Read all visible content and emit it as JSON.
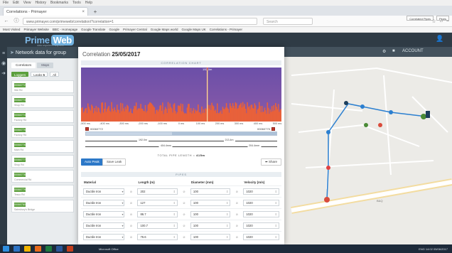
{
  "browser": {
    "menu": [
      "File",
      "Edit",
      "View",
      "History",
      "Bookmarks",
      "Tools",
      "Help"
    ],
    "tab_title": "Correlations - Primayer",
    "url": "www.primayer.com/primeweb/correlation/?correlation=1",
    "search_placeholder": "Search",
    "bookmarks": [
      "Most Visited",
      "Primayer Website",
      "BBC - Homepage",
      "Google Translate",
      "Google",
      "Primayer Central",
      "Google Maps world",
      "Google Maps UK",
      "Correlations - Primayer"
    ]
  },
  "app": {
    "logo_prime": "Prime",
    "logo_web": "Web",
    "logo_sub": "data anywhere, any time",
    "panel_title": "Network data for group",
    "tabs": [
      "Correlators",
      "Maps"
    ],
    "filters": [
      "Loggers",
      "Leaks",
      "All"
    ],
    "leak_count": "5",
    "loggers": [
      {
        "id": "00060772",
        "sub": "Site Rd"
      },
      {
        "id": "00060773",
        "sub": "Shop Rd"
      },
      {
        "id": "00060774",
        "sub": "Factory Rd"
      },
      {
        "id": "00060775",
        "sub": "Factory Rd"
      },
      {
        "id": "00060776",
        "sub": "Main Rd"
      },
      {
        "id": "00060777",
        "sub": "Shop Rd"
      },
      {
        "id": "00060778",
        "sub": "Commercial Rd"
      },
      {
        "id": "00060779",
        "sub": "Tesco Rd"
      },
      {
        "id": "00060780",
        "sub": "Sainsbury's Bridge"
      }
    ]
  },
  "map": {
    "toolbar_right": "ACCOUNT",
    "checks": [
      "Correlated Pipes",
      "Pipes"
    ]
  },
  "modal": {
    "title_prefix": "Correlation",
    "date": "25/05/2017",
    "chart_header": "CORRELATION CHART",
    "peak_label": "192.0m",
    "logger_a": "00060772",
    "logger_b": "00060775",
    "axis_ticks": [
      "-500 ms",
      "-400 ms",
      "-300 ms",
      "-200 ms",
      "-100 ms",
      "0 ms",
      "100 ms",
      "200 ms",
      "300 ms",
      "400 ms",
      "500 ms"
    ],
    "dim_left": "192.0m",
    "dim_right": "213.4m",
    "dim_a": "404.4mm",
    "dim_b": "204.4mm",
    "total_label": "TOTAL PIPE LENGTH =",
    "total_value": "415m",
    "buttons": {
      "primary": "Auto Peak",
      "secondary": "Save Leak",
      "share": "Share"
    },
    "pipes_header": "PIPES",
    "columns": [
      "Material",
      "Length (m)",
      "Diameter (mm)",
      "Velocity (m/s)"
    ],
    "rows": [
      {
        "material": "Ductile Iron",
        "length": "202",
        "diameter": "100",
        "velocity": "1020"
      },
      {
        "material": "Ductile Iron",
        "length": "127",
        "diameter": "100",
        "velocity": "1020"
      },
      {
        "material": "Ductile Iron",
        "length": "86.7",
        "diameter": "100",
        "velocity": "1020"
      },
      {
        "material": "Ductile Iron",
        "length": "100.7",
        "diameter": "100",
        "velocity": "1020"
      },
      {
        "material": "Ductile Iron",
        "length": "76.6",
        "diameter": "100",
        "velocity": "1020"
      }
    ]
  },
  "chart_data": {
    "type": "bar",
    "x_range": [
      -500,
      500
    ],
    "y_range": [
      0,
      1
    ],
    "xlabel": "ms",
    "peak_x": 130,
    "peak_value": 1.0,
    "baseline": 0.25,
    "colors": {
      "top": "#6b4fa8",
      "bottom": "#e8613a"
    }
  },
  "taskbar": {
    "label": "Microsoft Office",
    "tray": "ENG  14:02  05/06/2017"
  }
}
